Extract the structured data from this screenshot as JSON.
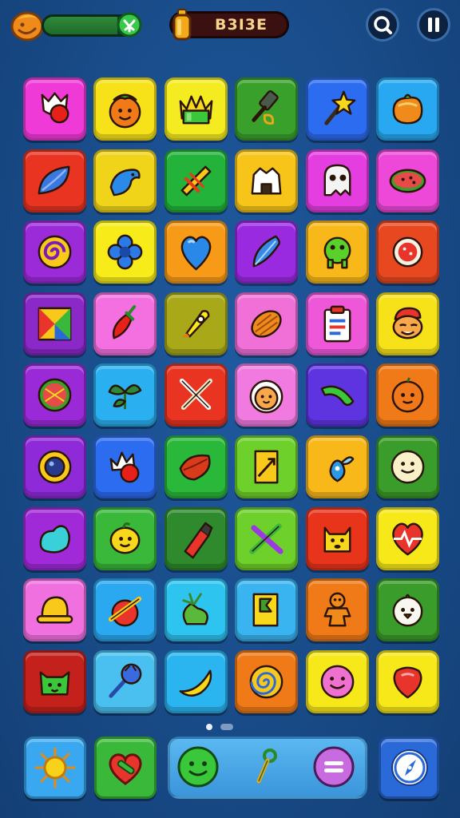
{
  "hud": {
    "energy_level": 0.78,
    "score": "B3I3E",
    "buttons": {
      "search_icon": "magnifier-icon",
      "pause_icon": "pause-icon"
    }
  },
  "board": {
    "rows": [
      [
        {
          "color": "#f03ad8",
          "icon": "tulip-icon"
        },
        {
          "color": "#f7e21a",
          "icon": "tomato-face-icon"
        },
        {
          "color": "#f4ec20",
          "icon": "crown-icon"
        },
        {
          "color": "#3aa02c",
          "icon": "shovel-icon"
        },
        {
          "color": "#2b6cf0",
          "icon": "star-wand-icon"
        },
        {
          "color": "#28a8f0",
          "icon": "orange-blob-icon"
        }
      ],
      [
        {
          "color": "#e83420",
          "icon": "blue-leaf-icon"
        },
        {
          "color": "#f0d41a",
          "icon": "blue-bird-icon"
        },
        {
          "color": "#23b23a",
          "icon": "bow-icon"
        },
        {
          "color": "#f7c51a",
          "icon": "tent-icon"
        },
        {
          "color": "#e43ee0",
          "icon": "ghost-icon"
        },
        {
          "color": "#ee48d8",
          "icon": "watermelon-bowl-icon"
        }
      ],
      [
        {
          "color": "#9b2ad8",
          "icon": "spiral-icon"
        },
        {
          "color": "#f7ec1a",
          "icon": "blue-flower-icon"
        },
        {
          "color": "#f79a18",
          "icon": "blue-heart-icon"
        },
        {
          "color": "#9a2ae0",
          "icon": "feather-icon"
        },
        {
          "color": "#f8b81a",
          "icon": "green-monster-icon"
        },
        {
          "color": "#e84820",
          "icon": "pizza-icon"
        }
      ],
      [
        {
          "color": "#8a28c8",
          "icon": "origami-icon"
        },
        {
          "color": "#f470e0",
          "icon": "chili-icon"
        },
        {
          "color": "#a8a818",
          "icon": "rocket-icon"
        },
        {
          "color": "#f070d8",
          "icon": "cocoa-pod-icon"
        },
        {
          "color": "#ee58d8",
          "icon": "clipboard-icon"
        },
        {
          "color": "#f7e21a",
          "icon": "sleepy-face-icon"
        }
      ],
      [
        {
          "color": "#9a2ad8",
          "icon": "watermelon-slice-icon"
        },
        {
          "color": "#2ab0f0",
          "icon": "green-leaves-icon"
        },
        {
          "color": "#e83420",
          "icon": "crossed-swords-icon"
        },
        {
          "color": "#f07ae0",
          "icon": "lion-face-icon"
        },
        {
          "color": "#5e34e0",
          "icon": "cucumber-icon"
        },
        {
          "color": "#f07a18",
          "icon": "orange-fruit-icon"
        }
      ],
      [
        {
          "color": "#8e2ad8",
          "icon": "sun-gear-icon"
        },
        {
          "color": "#2b6cf0",
          "icon": "crown-cherry-icon"
        },
        {
          "color": "#2ab83a",
          "icon": "red-leaf-icon"
        },
        {
          "color": "#6ed02a",
          "icon": "sign-board-icon"
        },
        {
          "color": "#f8b81a",
          "icon": "blue-fairy-icon"
        },
        {
          "color": "#3a9c2a",
          "icon": "smiley-ball-icon"
        }
      ],
      [
        {
          "color": "#a02ad8",
          "icon": "cyan-blob-icon"
        },
        {
          "color": "#3ab83a",
          "icon": "lemon-face-icon"
        },
        {
          "color": "#2e8a2c",
          "icon": "ketchup-icon"
        },
        {
          "color": "#6ed02a",
          "icon": "cross-pencils-icon"
        },
        {
          "color": "#e8341a",
          "icon": "yellow-dog-icon"
        },
        {
          "color": "#f7e81a",
          "icon": "heartbeat-icon"
        }
      ],
      [
        {
          "color": "#f070e0",
          "icon": "yellow-hat-icon"
        },
        {
          "color": "#2aa8f0",
          "icon": "rolling-pin-icon"
        },
        {
          "color": "#2ec4f0",
          "icon": "green-cabbage-icon"
        },
        {
          "color": "#3ab4f0",
          "icon": "flag-card-icon"
        },
        {
          "color": "#f07a18",
          "icon": "ginger-cookie-icon"
        },
        {
          "color": "#3a9c2a",
          "icon": "white-chick-icon"
        }
      ],
      [
        {
          "color": "#c4201c",
          "icon": "green-cat-icon"
        },
        {
          "color": "#4ac0f0",
          "icon": "ice-cream-icon"
        },
        {
          "color": "#2ab4f0",
          "icon": "banana-icon"
        },
        {
          "color": "#f07a18",
          "icon": "lollipop-swirl-icon"
        },
        {
          "color": "#f7e81a",
          "icon": "pink-smile-icon"
        },
        {
          "color": "#f7e81a",
          "icon": "heart-shield-icon"
        }
      ]
    ]
  },
  "pager": {
    "pages": 2,
    "active": 0
  },
  "bottom_bar": {
    "left_tiles": [
      {
        "color": "#3aa8f0",
        "icon": "sun-icon"
      },
      {
        "color": "#3ab83a",
        "icon": "heart-lock-icon"
      }
    ],
    "tray_items": [
      {
        "icon": "green-smile-icon"
      },
      {
        "icon": "key-icon"
      },
      {
        "icon": "menu-icon"
      }
    ],
    "right_tile": {
      "color": "#2a6ad8",
      "icon": "compass-icon"
    }
  }
}
